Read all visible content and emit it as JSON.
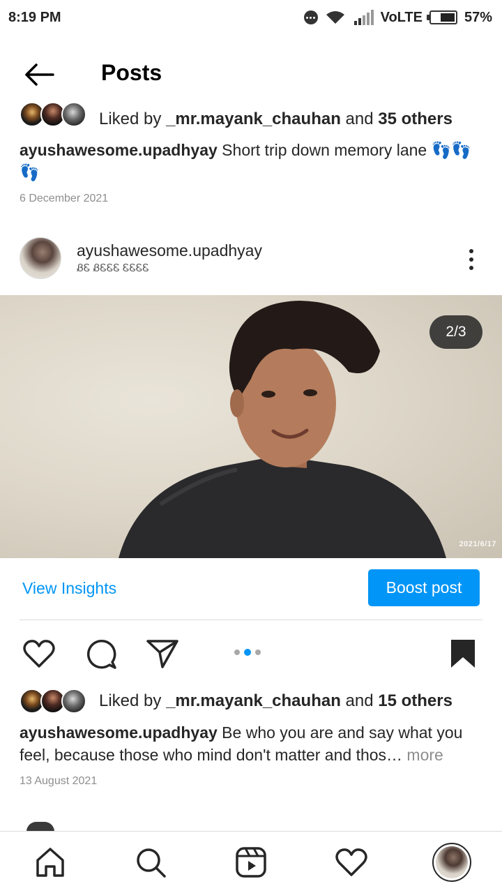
{
  "status_bar": {
    "time": "8:19 PM",
    "network": "VoLTE",
    "battery": "57%",
    "icons": [
      "more-icon",
      "wifi-icon",
      "signal-icon",
      "battery-icon"
    ]
  },
  "header": {
    "title": "Posts",
    "back_icon": "arrow-left-icon"
  },
  "previous_post": {
    "likes_prefix": "Liked by ",
    "likes_user": "_mr.mayank_chauhan",
    "likes_and": " and ",
    "likes_others": "35 others",
    "caption_user": "ayushawesome.upadhyay",
    "caption_text": " Short trip down memory lane 👣👣👣",
    "date": "6 December 2021"
  },
  "post": {
    "username": "ayushawesome.upadhyay",
    "subtitle": "ᏰᏋ ᏰᏋᏋᏋ ᏋᏋᏋᏋ",
    "media_counter": "2/3",
    "media_stamp": "2021/6/17",
    "view_insights": "View Insights",
    "boost_label": "Boost post",
    "carousel_index": 2,
    "carousel_total": 3,
    "likes_prefix": "Liked by ",
    "likes_user": "_mr.mayank_chauhan",
    "likes_and": " and ",
    "likes_others": "15 others",
    "caption_user": "ayushawesome.upadhyay",
    "caption_text": " Be who you are and say what you feel, because those who mind don't matter and thos",
    "caption_ellipsis": "…",
    "caption_more": " more",
    "date": "13 August 2021",
    "actions": [
      "heart-icon",
      "comment-icon",
      "share-icon",
      "bookmark-icon"
    ]
  },
  "bottom_nav": {
    "items": [
      "home-icon",
      "search-icon",
      "reels-icon",
      "heart-icon",
      "profile-avatar"
    ]
  },
  "colors": {
    "accent": "#0095f6",
    "text": "#262626",
    "muted": "#8e8e8e"
  }
}
